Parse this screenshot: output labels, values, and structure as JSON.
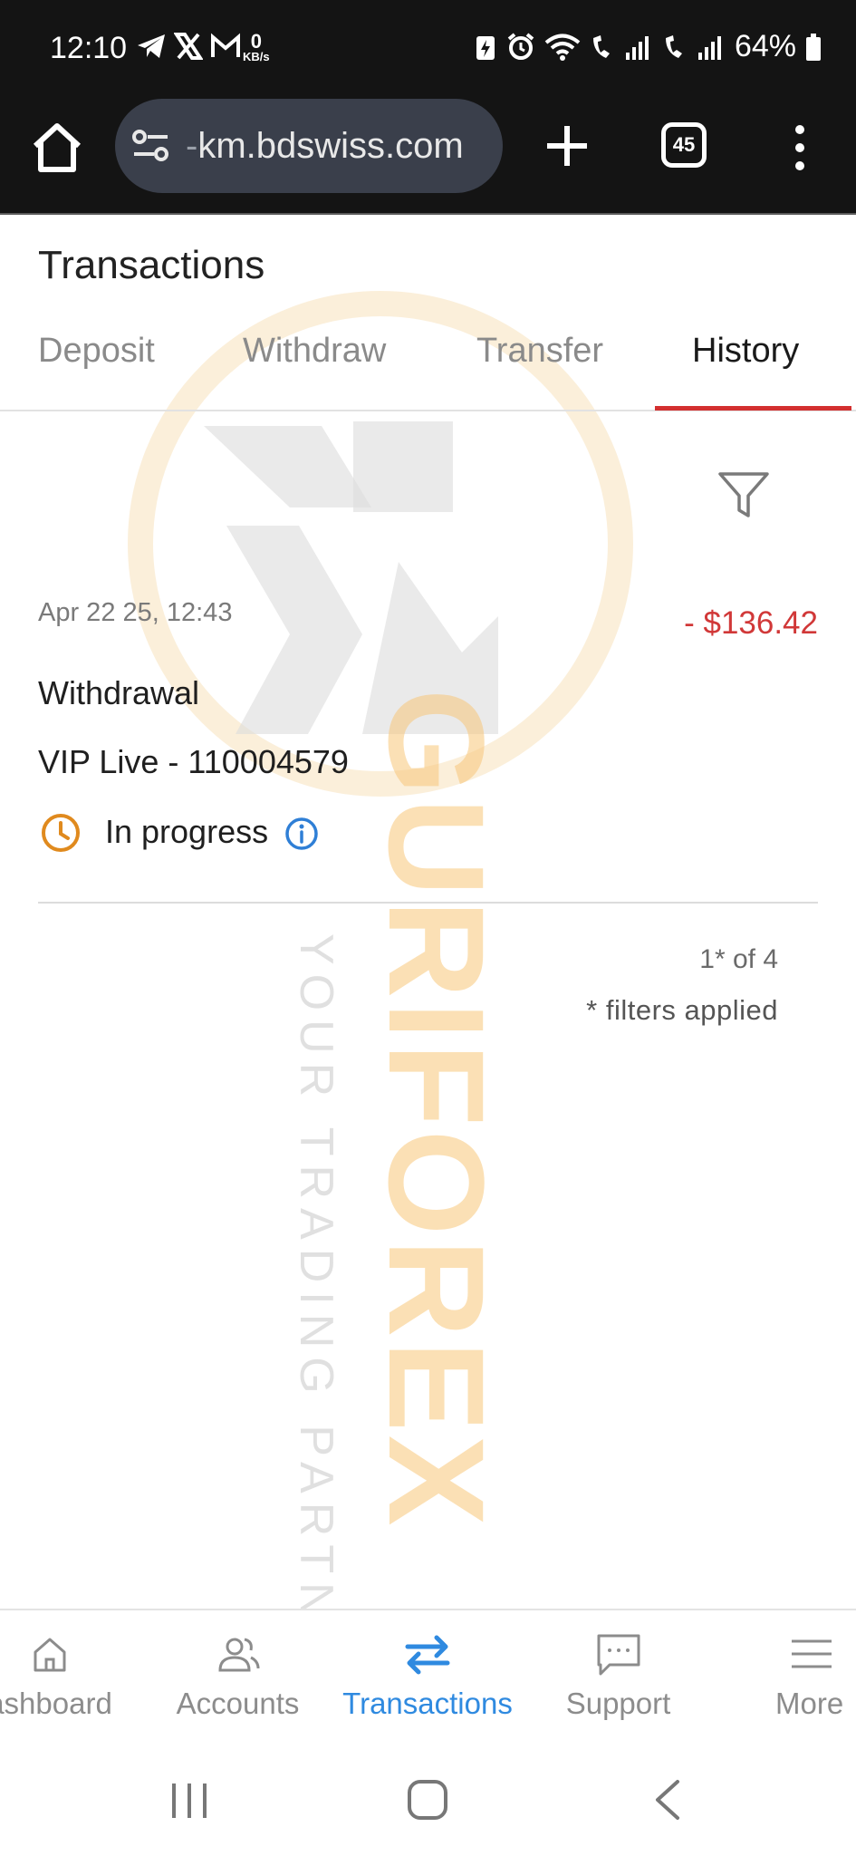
{
  "status_bar": {
    "time": "12:10",
    "net_speed_value": "0",
    "net_speed_unit": "KB/s",
    "battery": "64%"
  },
  "browser": {
    "url_prefix": "-",
    "url": "km.bdswiss.com",
    "tab_count": "45"
  },
  "page": {
    "title": "Transactions",
    "tabs": [
      {
        "label": "Deposit",
        "active": false
      },
      {
        "label": "Withdraw",
        "active": false
      },
      {
        "label": "Transfer",
        "active": false
      },
      {
        "label": "History",
        "active": true
      }
    ],
    "accent_color": "#d32f2f"
  },
  "transactions": [
    {
      "date": "Apr 22 25, 12:43",
      "amount": "- $136.42",
      "type": "Withdrawal",
      "account": "VIP Live - 110004579",
      "status": "In progress"
    }
  ],
  "pagination": {
    "count": "1* of 4",
    "note": "* filters applied"
  },
  "bottom_nav": {
    "items": [
      {
        "label": "ashboard",
        "icon": "home-icon",
        "active": false
      },
      {
        "label": "Accounts",
        "icon": "users-icon",
        "active": false
      },
      {
        "label": "Transactions",
        "icon": "swap-arrows-icon",
        "active": true
      },
      {
        "label": "Support",
        "icon": "chat-icon",
        "active": false
      },
      {
        "label": "More",
        "icon": "hamburger-icon",
        "active": false
      }
    ],
    "active_color": "#2f8ae0"
  },
  "watermark": {
    "brand": "GURIFOREX",
    "tagline": "YOUR TRADING PARTNER"
  }
}
